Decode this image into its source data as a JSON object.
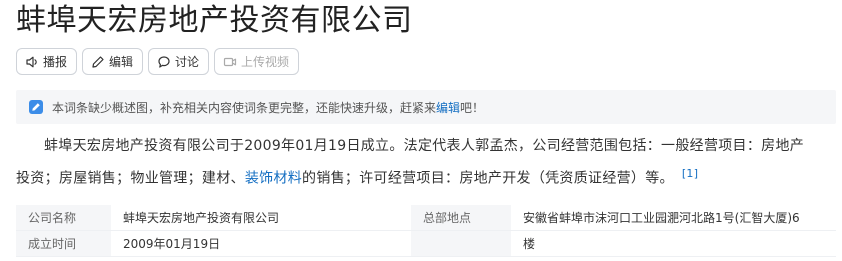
{
  "title": "蚌埠天宏房地产投资有限公司",
  "toolbar": {
    "play_label": "播报",
    "edit_label": "编辑",
    "discuss_label": "讨论",
    "upload_video_label": "上传视频"
  },
  "notice": {
    "text_before": "本词条缺少概述图，补充相关内容使词条更完整，还能快速升级，赶紧来",
    "link_text": "编辑",
    "text_after": "吧！"
  },
  "summary": {
    "part1": "蚌埠天宏房地产投资有限公司于2009年01月19日成立。法定代表人郭孟杰，公司经营范围包括：一般经营项目：房地产投资；房屋销售；物业管理；建材、",
    "link_text": "装饰材料",
    "part2": "的销售；许可经营项目：房地产开发（凭资质证经营）等。",
    "ref": "[1]"
  },
  "basic_info": {
    "row1": {
      "key1": "公司名称",
      "value1": "蚌埠天宏房地产投资有限公司",
      "key2": "总部地点",
      "value2": "安徽省蚌埠市沫河口工业园淝河北路1号(汇智大厦)6"
    },
    "row2": {
      "key1": "成立时间",
      "value1": "2009年01月19日",
      "key2": "",
      "value2": "楼"
    }
  },
  "colors": {
    "link": "#136ec2",
    "notice_bg": "#f5f6f8",
    "notice_icon": "#3c8de8"
  }
}
